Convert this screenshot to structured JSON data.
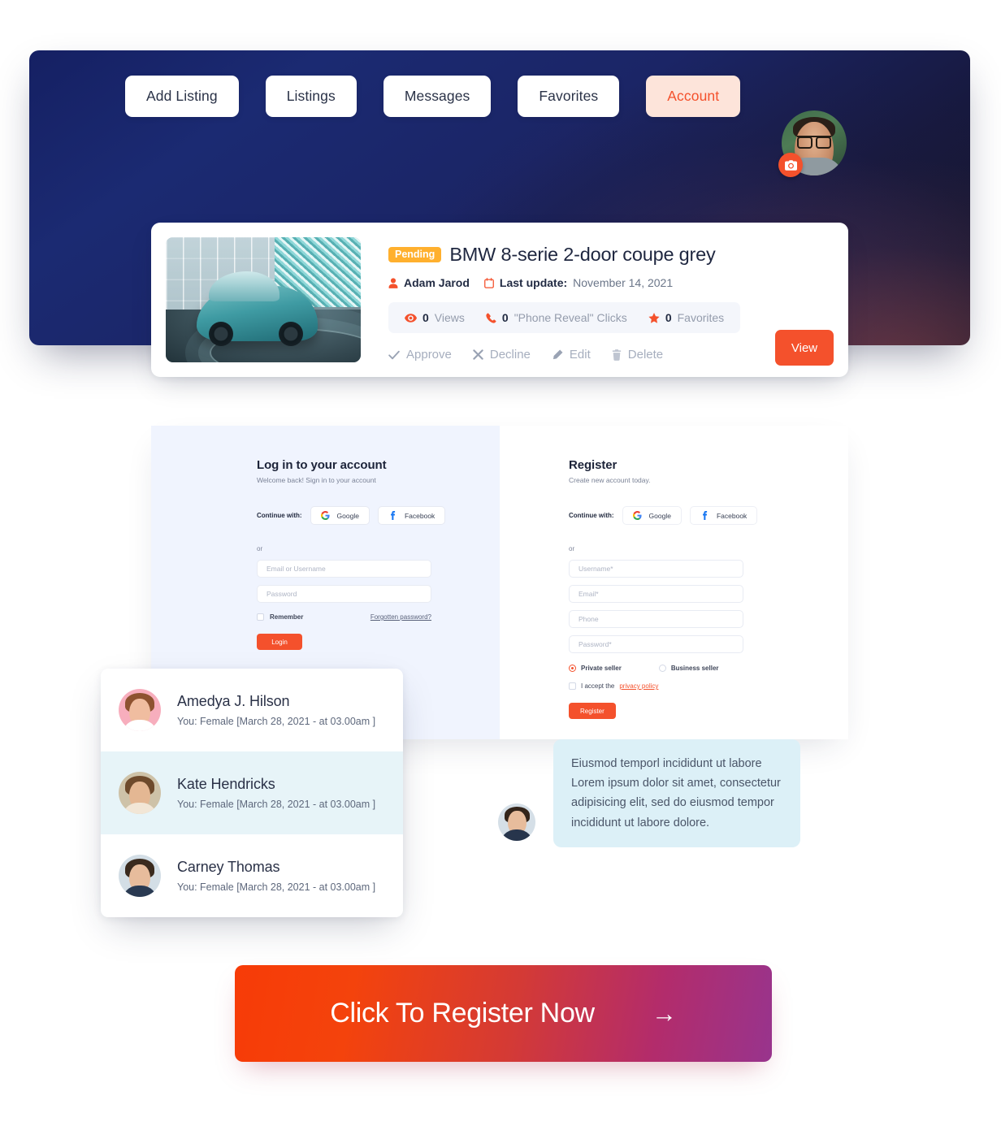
{
  "nav": {
    "items": [
      {
        "label": "Add Listing",
        "active": false
      },
      {
        "label": "Listings",
        "active": false
      },
      {
        "label": "Messages",
        "active": false
      },
      {
        "label": "Favorites",
        "active": false
      },
      {
        "label": "Account",
        "active": true
      }
    ]
  },
  "listing": {
    "badge": "Pending",
    "title": "BMW 8-serie 2-door coupe grey",
    "author": "Adam Jarod",
    "update_label": "Last update:",
    "update_date": "November 14, 2021",
    "stats": [
      {
        "count": "0",
        "label": "Views",
        "icon": "eye-icon"
      },
      {
        "count": "0",
        "label": "\"Phone Reveal\" Clicks",
        "icon": "phone-icon"
      },
      {
        "count": "0",
        "label": "Favorites",
        "icon": "star-icon"
      }
    ],
    "actions": [
      {
        "label": "Approve",
        "icon": "check-icon"
      },
      {
        "label": "Decline",
        "icon": "cross-icon"
      },
      {
        "label": "Edit",
        "icon": "pencil-icon"
      },
      {
        "label": "Delete",
        "icon": "trash-icon"
      }
    ],
    "view_button": "View"
  },
  "login": {
    "heading": "Log in to your account",
    "subheading": "Welcome back! Sign in to your account",
    "continue_label": "Continue with:",
    "google": "Google",
    "facebook": "Facebook",
    "or": "or",
    "email_placeholder": "Email or Username",
    "password_placeholder": "Password",
    "remember_label": "Remember",
    "forgot_label": "Forgotten password?",
    "submit": "Login"
  },
  "register": {
    "heading": "Register",
    "subheading": "Create new account today.",
    "continue_label": "Continue with:",
    "google": "Google",
    "facebook": "Facebook",
    "or": "or",
    "username_placeholder": "Username*",
    "email_placeholder": "Email*",
    "phone_placeholder": "Phone",
    "password_placeholder": "Password*",
    "seller_private": "Private seller",
    "seller_business": "Business seller",
    "accept_prefix": "I accept the",
    "privacy_link": "privacy policy",
    "submit": "Register"
  },
  "messages": {
    "rows": [
      {
        "name": "Amedya J. Hilson",
        "preview": "You: Female [March 28, 2021 - at 03.00am ]",
        "selected": false
      },
      {
        "name": "Kate Hendricks",
        "preview": "You: Female [March 28, 2021 - at 03.00am ]",
        "selected": true
      },
      {
        "name": "Carney Thomas",
        "preview": "You: Female [March 28, 2021 - at 03.00am ]",
        "selected": false
      }
    ]
  },
  "chat": {
    "bubble_text": "Eiusmod temporl incididunt ut labore Lorem ipsum dolor sit amet, consectetur adipisicing elit, sed do eiusmod tempor incididunt ut labore dolore."
  },
  "cta": {
    "label": "Click To Register Now",
    "arrow": "→"
  },
  "colors": {
    "accent": "#F4512C",
    "pending": "#FFB02E",
    "hero_navy": "#1b2a72",
    "panel_blue": "#F0F4FE",
    "selected_row": "#E7F4F8",
    "bubble": "#DCF0F7"
  }
}
